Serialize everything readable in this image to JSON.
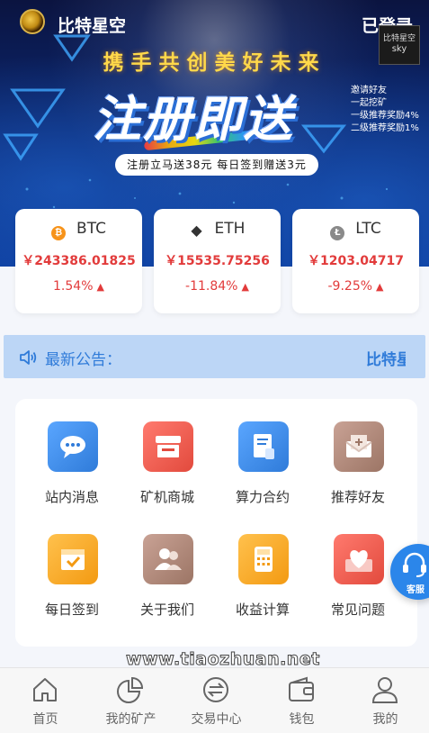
{
  "header": {
    "app_name": "比特星空",
    "login_label": "已登录"
  },
  "banner": {
    "slogan": "携手共创美好未来",
    "headline": "注册即送",
    "promo_pill": "注册立马送38元 每日签到赠送3元",
    "promo_right": [
      "邀请好友",
      "一起挖矿",
      "一级推荐奖励4%",
      "二级推荐奖励1%"
    ],
    "sky_seal": "比特星空",
    "sky_word": "sky"
  },
  "prices": [
    {
      "symbol": "BTC",
      "price": "￥243386.01825",
      "change": "1.54%",
      "icon": "bitcoin-icon",
      "color": "#f7931a"
    },
    {
      "symbol": "ETH",
      "price": "￥15535.75256",
      "change": "-11.84%",
      "icon": "ethereum-icon",
      "color": "#333333"
    },
    {
      "symbol": "LTC",
      "price": "￥1203.04717",
      "change": "-9.25%",
      "icon": "litecoin-icon",
      "color": "#8a8a8a"
    }
  ],
  "notice": {
    "title": "最新公告：",
    "marquee": "比特星空"
  },
  "menu": [
    {
      "label": "站内消息",
      "icon": "chat-bubble-icon",
      "color": "#3d8ef0"
    },
    {
      "label": "矿机商城",
      "icon": "shop-icon",
      "color": "#ee5a4f"
    },
    {
      "label": "算力合约",
      "icon": "contract-icon",
      "color": "#3d8ef0"
    },
    {
      "label": "推荐好友",
      "icon": "envelope-icon",
      "color": "#b08a7a"
    },
    {
      "label": "每日签到",
      "icon": "checkin-icon",
      "color": "#f6a623"
    },
    {
      "label": "关于我们",
      "icon": "people-icon",
      "color": "#b08a7a"
    },
    {
      "label": "收益计算",
      "icon": "calculator-icon",
      "color": "#f6a623"
    },
    {
      "label": "常见问题",
      "icon": "heart-icon",
      "color": "#ee5a4f"
    }
  ],
  "service": {
    "label": "客服"
  },
  "watermark": "www.tiaozhuan.net",
  "tabs": [
    {
      "label": "首页",
      "icon": "home-icon"
    },
    {
      "label": "我的矿产",
      "icon": "pie-chart-icon"
    },
    {
      "label": "交易中心",
      "icon": "exchange-icon"
    },
    {
      "label": "钱包",
      "icon": "wallet-icon"
    },
    {
      "label": "我的",
      "icon": "user-icon"
    }
  ],
  "colors": {
    "accent": "#2f7bd9",
    "price_red": "#e23b3b",
    "notice_bg": "#bcd6f6"
  }
}
